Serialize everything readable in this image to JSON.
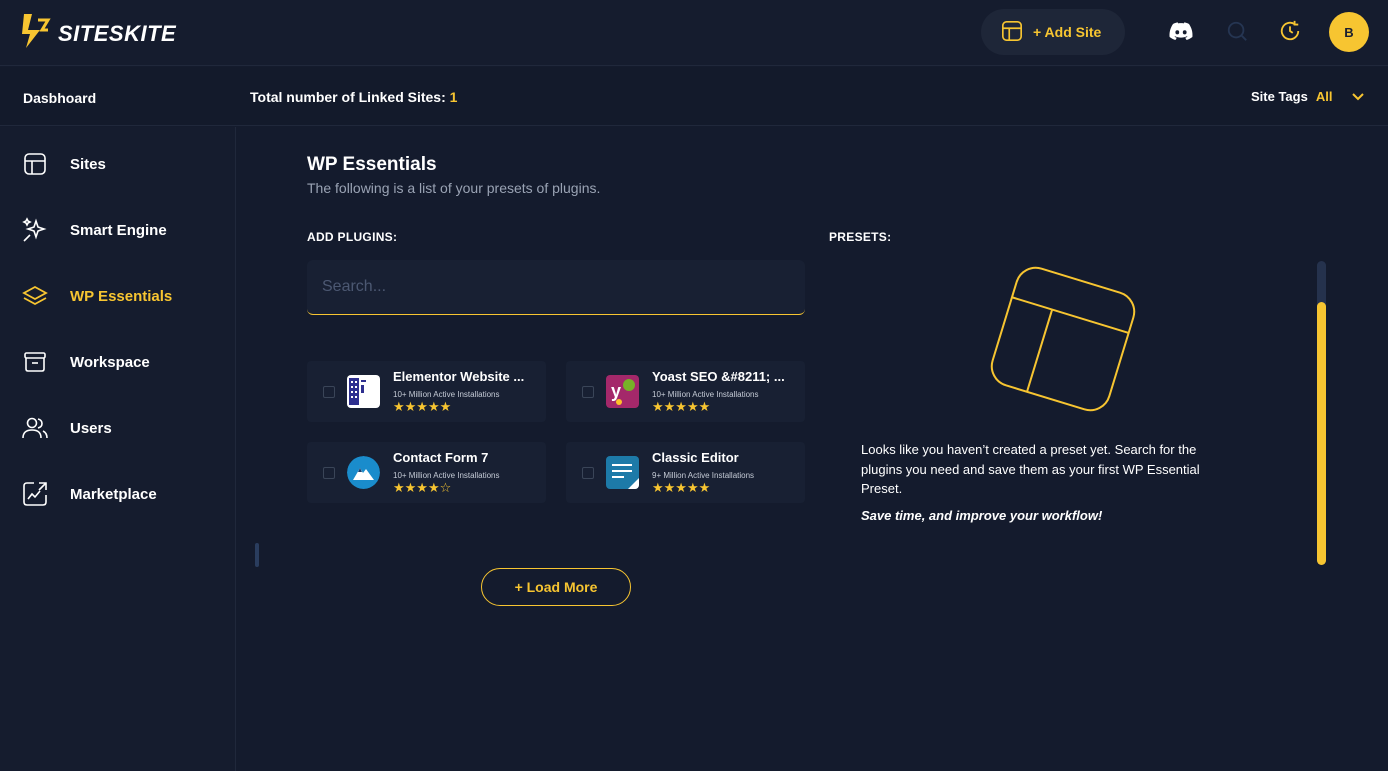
{
  "app": {
    "brand": "SITESKITE",
    "colors": {
      "accent": "#f7c531",
      "background": "#141b2d",
      "panel": "#182033"
    }
  },
  "header": {
    "add_site_label": "+ Add Site",
    "icons": [
      "layout-icon",
      "discord-icon",
      "search-icon",
      "history-icon"
    ],
    "avatar_initial": "B"
  },
  "subbar": {
    "breadcrumb": "Dasbhoard",
    "linked_label": "Total number of Linked Sites:",
    "linked_count": "1",
    "tags_label": "Site Tags",
    "tags_value": "All"
  },
  "sidebar": {
    "items": [
      {
        "label": "Sites",
        "icon": "layout-icon",
        "active": false
      },
      {
        "label": "Smart Engine",
        "icon": "sparkles-icon",
        "active": false
      },
      {
        "label": "WP Essentials",
        "icon": "layers-icon",
        "active": true
      },
      {
        "label": "Workspace",
        "icon": "archive-icon",
        "active": false
      },
      {
        "label": "Users",
        "icon": "users-icon",
        "active": false
      },
      {
        "label": "Marketplace",
        "icon": "marketplace-icon",
        "active": false
      }
    ]
  },
  "page": {
    "title": "WP Essentials",
    "subtitle": "The following is a list of your presets of plugins.",
    "add_plugins_label": "ADD PLUGINS:",
    "presets_label": "PRESETS:",
    "search_placeholder": "Search...",
    "load_more_label": "+ Load More"
  },
  "plugins": [
    {
      "name": "Elementor Website ...",
      "installs": "10+ Million Active Installations",
      "rating": "★★★★★",
      "rating_value": 5,
      "icon": "elementor-icon"
    },
    {
      "name": "Yoast SEO &#8211; ...",
      "installs": "10+ Million Active Installations",
      "rating": "★★★★★",
      "rating_value": 5,
      "icon": "yoast-icon"
    },
    {
      "name": "Contact Form 7",
      "installs": "10+ Million Active Installations",
      "rating": "★★★★☆",
      "rating_value": 4,
      "icon": "contact-form-7-icon"
    },
    {
      "name": "Classic Editor",
      "installs": "9+ Million Active Installations",
      "rating": "★★★★★",
      "rating_value": 5,
      "icon": "classic-editor-icon"
    }
  ],
  "presets": {
    "empty_message": "Looks like you haven’t created a preset yet. Search for the plugins you need and save them as your first WP Essential Preset.",
    "empty_emphasis": "Save time, and improve your workflow!"
  }
}
